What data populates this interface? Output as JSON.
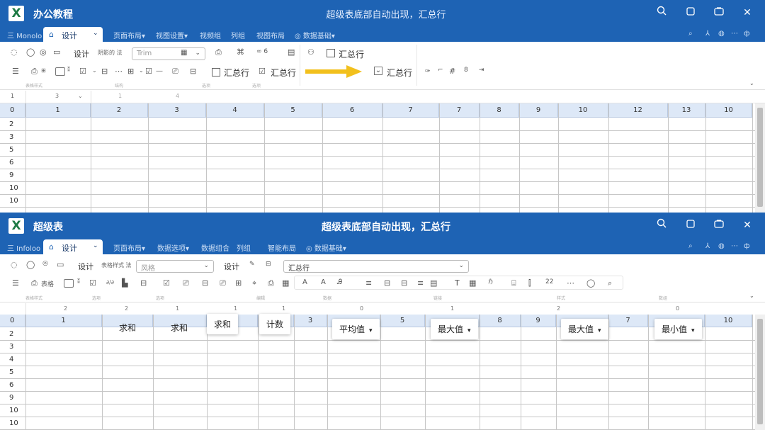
{
  "top": {
    "app_name": "办公教程",
    "window_title": "超级表底部自动出现，汇总行",
    "menu": {
      "first": "三 Monolo",
      "active_tab": "设计",
      "items": [
        "页面布局▾",
        "视图设置▾",
        "视频组",
        "列组",
        "视图布局",
        "◎ 数据基础▾"
      ]
    },
    "ribbon": {
      "row1_label_design": "设计",
      "row1_small_1": "阴影的 法",
      "row1_dropbox": "Trim",
      "summary_row_label": "汇总行",
      "row2_summary_label_1": "汇总行",
      "row2_summary_label_2": "汇总行",
      "row2_summary_label_3": "汇总行",
      "group_labels": [
        "表格样式",
        "结构",
        "选项",
        "选项"
      ]
    },
    "formula_bar": {
      "cell_ref": "1",
      "f1": "3",
      "f2": "1",
      "f3": "4"
    },
    "columns": [
      "0",
      "1",
      "2",
      "3",
      "4",
      "5",
      "6",
      "7",
      "7",
      "8",
      "9",
      "10",
      "12",
      "13",
      "10"
    ],
    "rows": [
      "2",
      "3",
      "5",
      "6",
      "9",
      "10",
      "10"
    ]
  },
  "bottom": {
    "app_name": "超级表",
    "window_title": "超级表底部自动出现，汇总行",
    "menu": {
      "first": "三 Infoloo",
      "active_tab": "设计",
      "items": [
        "页面布局▾",
        "数据选项▾",
        "数据组合",
        "列组",
        "智能布局",
        "◎ 数据基础▾"
      ]
    },
    "ribbon": {
      "row1_design_label": "设计",
      "row1_small_1": "表格样式 法",
      "row1_dropbox": "风格",
      "row1_design_label_2": "设计",
      "row1_dropbox_2": "汇总行",
      "row2_text_1": "表格",
      "group_labels": [
        "表格样式",
        "选项",
        "选项",
        "编辑",
        "数据",
        "链接",
        "样式",
        "数组"
      ]
    },
    "formula_bar": {
      "f1": "2",
      "f2": "2",
      "f3": "1",
      "f4": "1",
      "f5": "1",
      "f6": "0",
      "f7": "1",
      "f8": "2",
      "f9": "0"
    },
    "columns": [
      "0",
      "1",
      "",
      "",
      "",
      "",
      "3",
      "",
      "5",
      "",
      "8",
      "9",
      "",
      "7",
      "",
      "10"
    ],
    "rows": [
      "2",
      "3",
      "4",
      "5",
      "6",
      "9",
      "10",
      "10"
    ],
    "cell_values": [
      "求和",
      "求和"
    ],
    "popups": [
      {
        "label": "求和",
        "dropdown": false
      },
      {
        "label": "计数",
        "dropdown": false
      },
      {
        "label": "平均值",
        "dropdown": true
      },
      {
        "label": "最大值",
        "dropdown": true
      },
      {
        "label": "最大值",
        "dropdown": true
      },
      {
        "label": "最小值",
        "dropdown": true
      }
    ]
  },
  "colors": {
    "titlebar": "#1e63b4",
    "arrow": "#f2c01c",
    "header_fill": "#dde8f7"
  }
}
